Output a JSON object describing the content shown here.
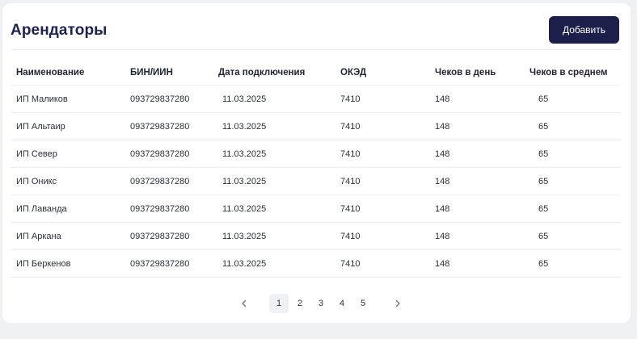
{
  "header": {
    "title": "Арендаторы",
    "add_label": "Добавить"
  },
  "table": {
    "columns": [
      "Наименование",
      "БИН/ИИН",
      "Дата подключения",
      "ОКЭД",
      "Чеков в день",
      "Чеков в среднем"
    ],
    "rows": [
      [
        "ИП Маликов",
        "093729837280",
        "11.03.2025",
        "7410",
        "148",
        "65"
      ],
      [
        "ИП Альтаир",
        "093729837280",
        "11.03.2025",
        "7410",
        "148",
        "65"
      ],
      [
        "ИП Север",
        "093729837280",
        "11.03.2025",
        "7410",
        "148",
        "65"
      ],
      [
        "ИП Оникс",
        "093729837280",
        "11.03.2025",
        "7410",
        "148",
        "65"
      ],
      [
        "ИП Лаванда",
        "093729837280",
        "11.03.2025",
        "7410",
        "148",
        "65"
      ],
      [
        "ИП Аркана",
        "093729837280",
        "11.03.2025",
        "7410",
        "148",
        "65"
      ],
      [
        "ИП Беркенов",
        "093729837280",
        "11.03.2025",
        "7410",
        "148",
        "65"
      ]
    ]
  },
  "pagination": {
    "pages": [
      "1",
      "2",
      "3",
      "4",
      "5"
    ],
    "current": "1",
    "prev_icon": "chevron-left-icon",
    "next_icon": "chevron-right-icon"
  },
  "colors": {
    "accent": "#1c1f4a",
    "title": "#1d2350",
    "background": "#eef0f3"
  }
}
